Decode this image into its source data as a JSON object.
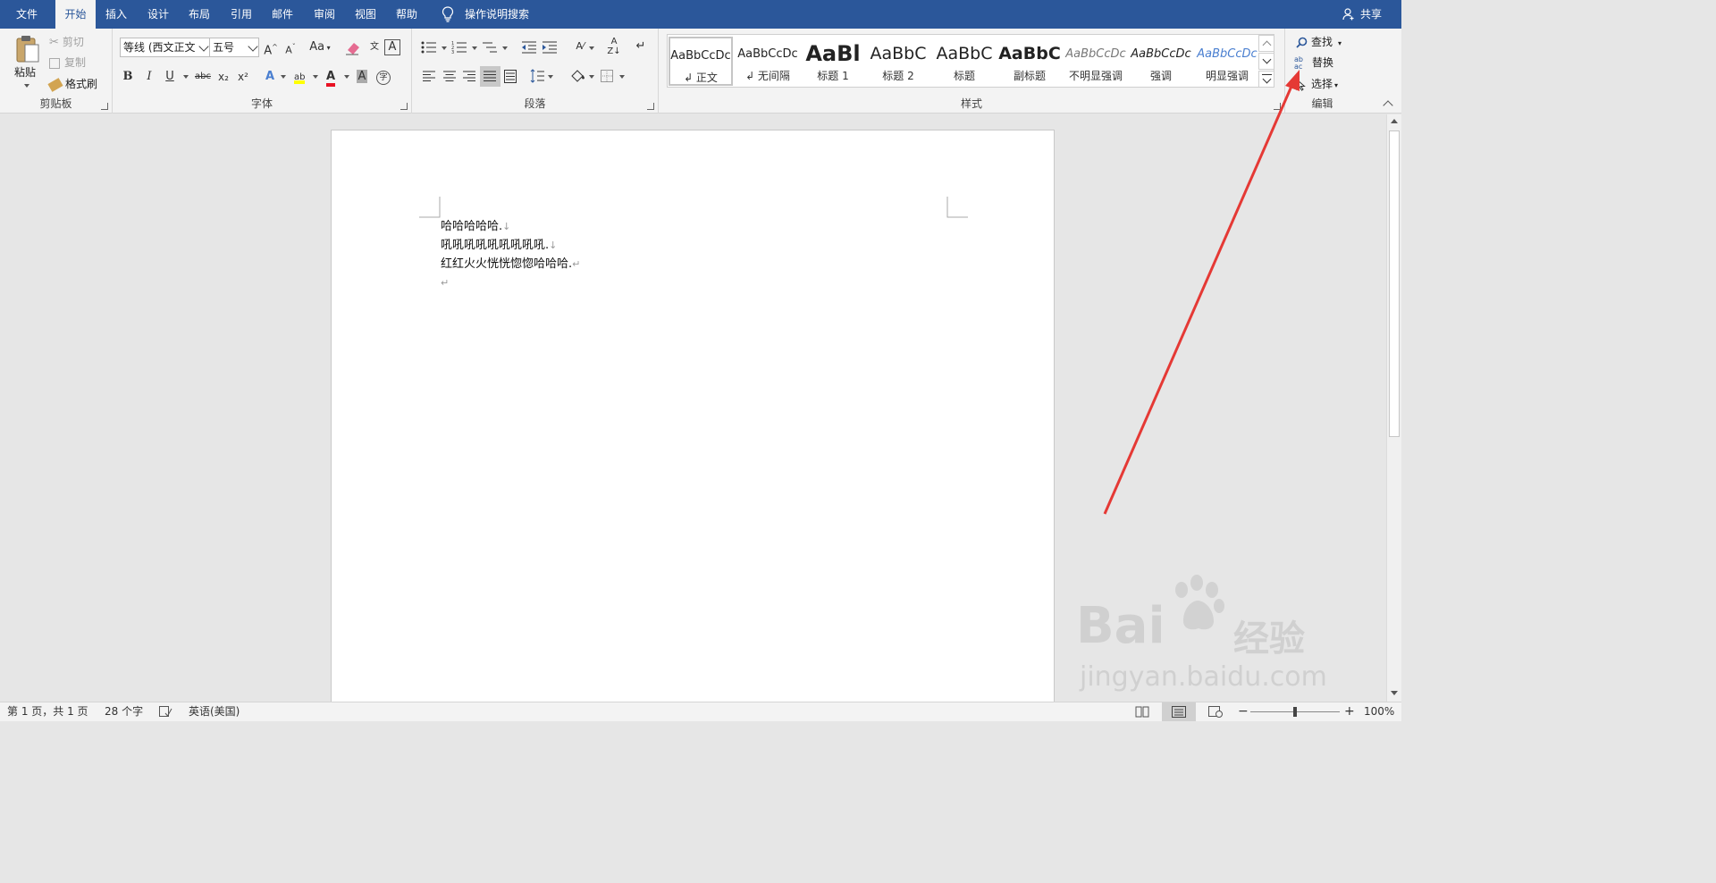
{
  "tabs": [
    {
      "label": "文件",
      "active": false
    },
    {
      "label": "开始",
      "active": true
    },
    {
      "label": "插入",
      "active": false
    },
    {
      "label": "设计",
      "active": false
    },
    {
      "label": "布局",
      "active": false
    },
    {
      "label": "引用",
      "active": false
    },
    {
      "label": "邮件",
      "active": false
    },
    {
      "label": "审阅",
      "active": false
    },
    {
      "label": "视图",
      "active": false
    },
    {
      "label": "帮助",
      "active": false
    }
  ],
  "tell_me": "操作说明搜索",
  "share": "共享",
  "clipboard": {
    "label": "剪贴板",
    "paste": "粘贴",
    "cut": "剪切",
    "copy": "复制",
    "format_painter": "格式刷"
  },
  "font": {
    "label": "字体",
    "font_name": "等线 (西文正文",
    "font_size": "五号",
    "bold": "B",
    "italic": "I",
    "underline": "U",
    "strike": "abc",
    "subscript": "x₂",
    "superscript": "x²",
    "grow": "A",
    "shrink": "A",
    "change_case": "Aa",
    "font_color_hex": "#e81123",
    "highlight_hex": "#ffff00"
  },
  "paragraph": {
    "label": "段落"
  },
  "styles": {
    "label": "样式",
    "items": [
      {
        "preview": "AaBbCcDc",
        "name": "↲ 正文",
        "selected": true
      },
      {
        "preview": "AaBbCcDc",
        "name": "↲ 无间隔",
        "selected": false
      },
      {
        "preview": "AaBl",
        "name": "标题 1",
        "selected": false
      },
      {
        "preview": "AaBbC",
        "name": "标题 2",
        "selected": false
      },
      {
        "preview": "AaBbC",
        "name": "标题",
        "selected": false
      },
      {
        "preview": "AaBbC",
        "name": "副标题",
        "selected": false
      },
      {
        "preview": "AaBbCcDc",
        "name": "不明显强调",
        "selected": false
      },
      {
        "preview": "AaBbCcDc",
        "name": "强调",
        "selected": false
      },
      {
        "preview": "AaBbCcDc",
        "name": "明显强调",
        "selected": false
      }
    ]
  },
  "editing": {
    "label": "编辑",
    "find": "查找",
    "replace": "替换",
    "select": "选择"
  },
  "document": {
    "lines": [
      {
        "text": "哈哈哈哈哈.",
        "mark": "↓"
      },
      {
        "text": "吼吼吼吼吼吼吼吼吼.",
        "mark": "↓"
      },
      {
        "text": "红红火火恍恍惚惚哈哈哈.",
        "mark": "↵"
      },
      {
        "text": "",
        "mark": "↵"
      }
    ]
  },
  "status": {
    "page": "第 1 页，共 1 页",
    "words": "28 个字",
    "language": "英语(美国)",
    "zoom": "100%"
  },
  "watermark": {
    "brand": "Bai",
    "brand_cn": "经验",
    "url": "jingyan.baidu.com"
  },
  "colors": {
    "accent": "#2b579a",
    "arrow": "#e53935"
  }
}
